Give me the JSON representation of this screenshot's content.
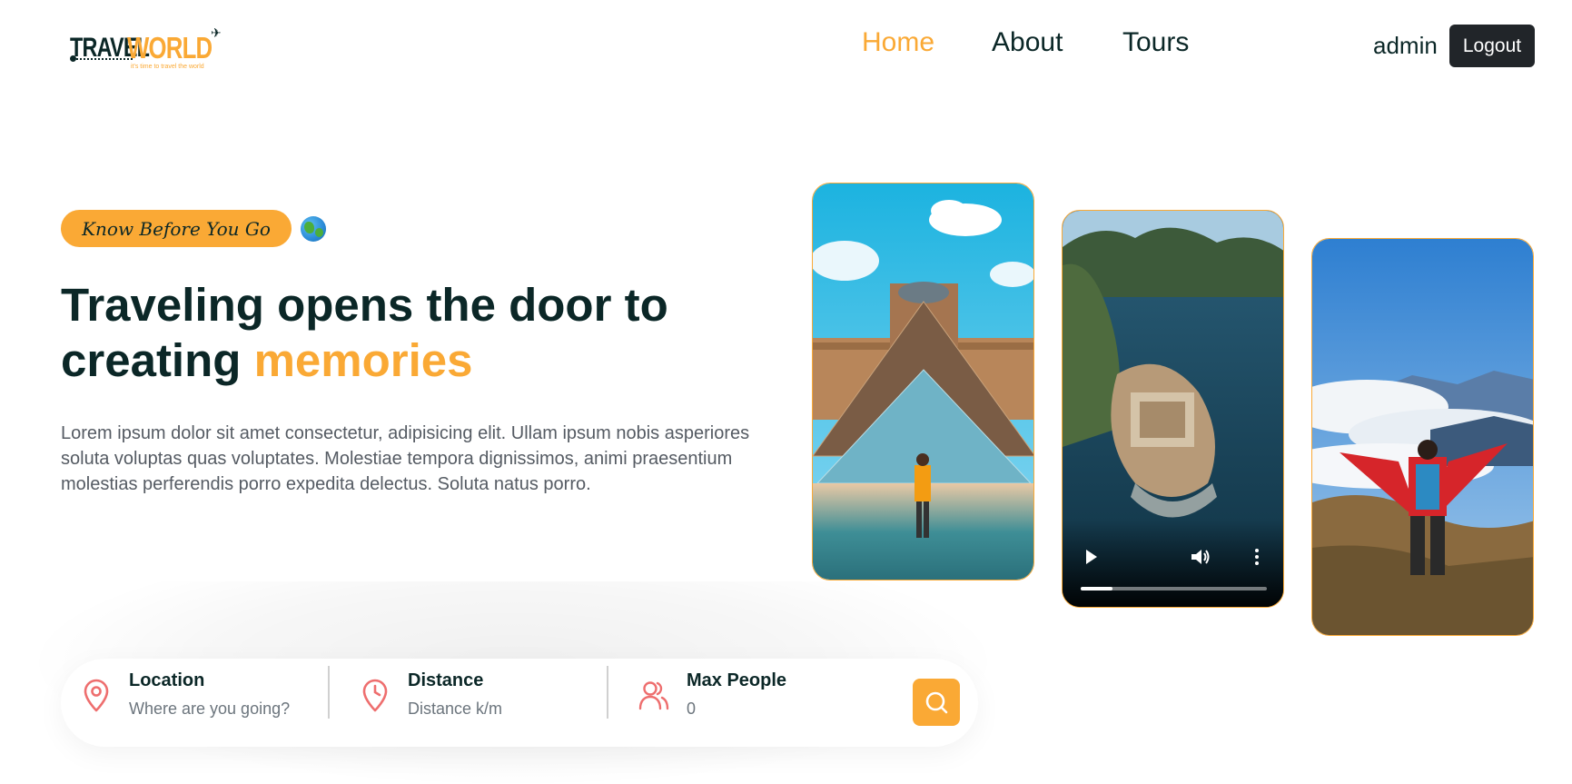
{
  "header": {
    "logo": {
      "word1": "TRAVEL",
      "word2": "WORLD",
      "tagline": "it's time to travel the world"
    },
    "nav": [
      {
        "label": "Home",
        "active": true
      },
      {
        "label": "About",
        "active": false
      },
      {
        "label": "Tours",
        "active": false
      }
    ],
    "user": "admin",
    "logout_label": "Logout"
  },
  "hero": {
    "subtitle": "Know Before You Go",
    "title_part1": "Traveling opens the door to creating ",
    "title_highlight": "memories",
    "description": "Lorem ipsum dolor sit amet consectetur, adipisicing elit. Ullam ipsum nobis asperiores soluta voluptas quas voluptates. Molestiae tempora dignissimos, animi praesentium molestias perferendis porro expedita delectus. Soluta natus porro.",
    "media": [
      {
        "kind": "image",
        "subject": "louvre-pyramid"
      },
      {
        "kind": "video",
        "subject": "island-fortress",
        "progress": 0.17
      },
      {
        "kind": "image",
        "subject": "hiker-mountain"
      }
    ]
  },
  "search": {
    "location": {
      "label": "Location",
      "placeholder": "Where are you going?",
      "icon": "map-pin-icon"
    },
    "distance": {
      "label": "Distance",
      "placeholder": "Distance k/m",
      "icon": "clock-icon"
    },
    "max_people": {
      "label": "Max People",
      "placeholder": "0",
      "icon": "users-icon"
    },
    "button_icon": "search-icon"
  },
  "colors": {
    "accent": "#faa935",
    "heading": "#0b2727",
    "text": "#555b63",
    "icon": "#ee6e6e",
    "dark_button": "#212529"
  }
}
